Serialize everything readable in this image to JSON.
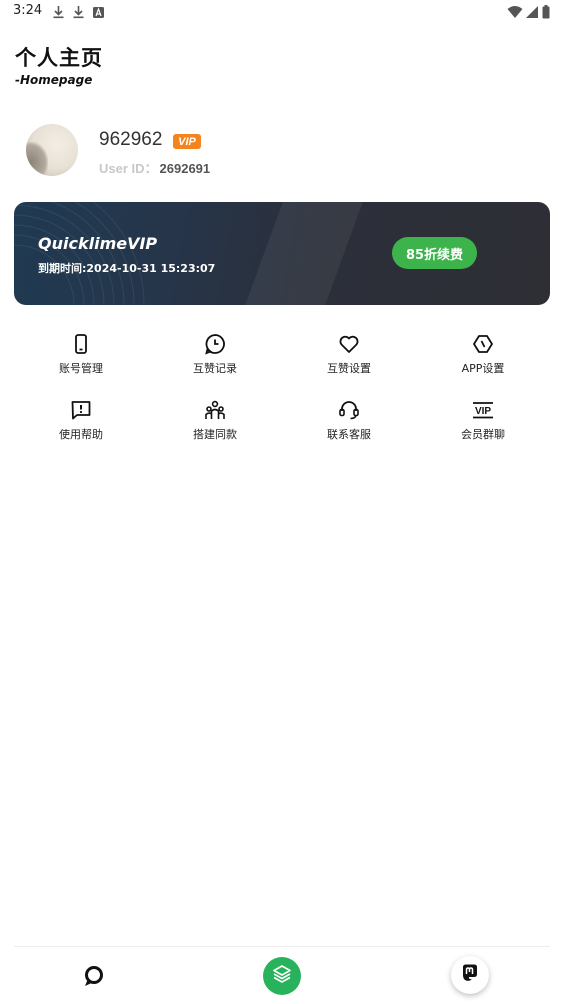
{
  "status_bar": {
    "time": "3:24",
    "left_icons": [
      "download-icon",
      "download-icon",
      "notification-a-icon"
    ],
    "right_icons": [
      "wifi-icon",
      "signal-icon",
      "battery-icon"
    ]
  },
  "header": {
    "title": "个人主页",
    "subtitle": "-Homepage"
  },
  "profile": {
    "username": "962962",
    "vip_badge": "VIP",
    "user_id_label": "User ID：",
    "user_id_value": "2692691"
  },
  "vip_card": {
    "title": "QuicklimeVIP",
    "expiry": "到期时间:2024-10-31 15:23:07",
    "renew_button": "85折续费",
    "accent_color": "#3cb44b"
  },
  "menu": {
    "items": [
      {
        "label": "账号管理",
        "icon": "phone-icon"
      },
      {
        "label": "互赞记录",
        "icon": "clock-icon"
      },
      {
        "label": "互赞设置",
        "icon": "heart-icon"
      },
      {
        "label": "APP设置",
        "icon": "hexagon-icon"
      },
      {
        "label": "使用帮助",
        "icon": "help-message-icon"
      },
      {
        "label": "搭建同款",
        "icon": "group-icon"
      },
      {
        "label": "联系客服",
        "icon": "headset-icon"
      },
      {
        "label": "会员群聊",
        "icon": "vip-icon"
      }
    ]
  },
  "bottom_nav": {
    "items": [
      "chat-icon",
      "layers-icon",
      "mastodon-icon"
    ],
    "center_color": "#27b25b"
  }
}
